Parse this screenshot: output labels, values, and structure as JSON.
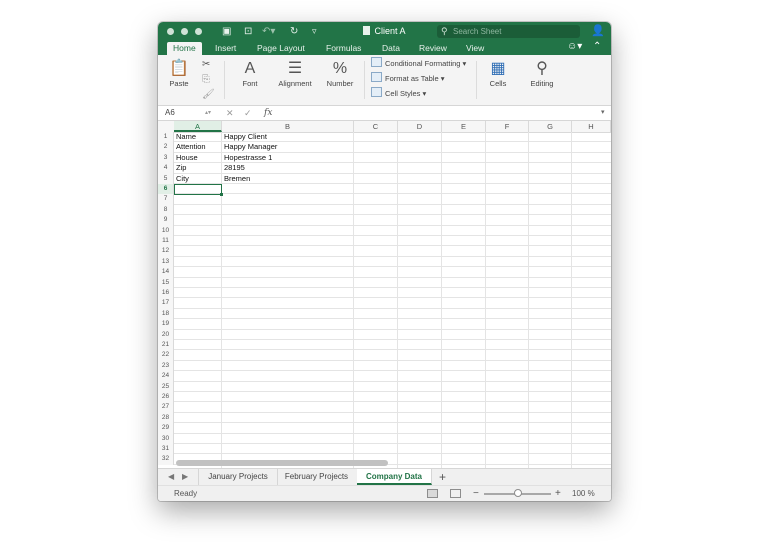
{
  "window": {
    "title": "Client A"
  },
  "search": {
    "placeholder": "Search Sheet"
  },
  "tabs": [
    "Home",
    "Insert",
    "Page Layout",
    "Formulas",
    "Data",
    "Review",
    "View"
  ],
  "ribbon": {
    "paste": "Paste",
    "font": "Font",
    "alignment": "Alignment",
    "number": "Number",
    "conditional_formatting": "Conditional Formatting",
    "format_as_table": "Format as Table",
    "cell_styles": "Cell Styles",
    "cells": "Cells",
    "editing": "Editing"
  },
  "formula_bar": {
    "name_box": "A6",
    "fx": "fx",
    "formula": ""
  },
  "columns": [
    "A",
    "B",
    "C",
    "D",
    "E",
    "F",
    "G",
    "H"
  ],
  "rows": [
    "1",
    "2",
    "3",
    "4",
    "5",
    "6",
    "7",
    "8",
    "9",
    "10",
    "11",
    "12",
    "13",
    "14",
    "15",
    "16",
    "17",
    "18",
    "19",
    "20",
    "21",
    "22",
    "23",
    "24",
    "25",
    "26",
    "27",
    "28",
    "29",
    "30",
    "31",
    "32"
  ],
  "cells": {
    "A1": "Name",
    "B1": "Happy Client",
    "A2": "Attention",
    "B2": "Happy Manager",
    "A3": "House",
    "B3": "Hopestrasse 1",
    "A4": "Zip",
    "B4": "28195",
    "A5": "City",
    "B5": "Bremen"
  },
  "selected_cell": "A6",
  "sheets": [
    "January Projects",
    "February Projects",
    "Company Data"
  ],
  "active_sheet": "Company Data",
  "status": {
    "text": "Ready",
    "zoom": "100 %",
    "zoom_level": 1.0
  },
  "colors": {
    "accent": "#227447",
    "ribbon_bg": "#f4f4f4",
    "grid_line": "#e4e4e4"
  },
  "icons": [
    "close-window-icon",
    "minimize-window-icon",
    "zoom-window-icon",
    "sidebar-toggle-icon",
    "save-icon",
    "undo-icon",
    "redo-icon",
    "customize-toolbar-icon",
    "document-icon",
    "search-icon",
    "share-user-icon",
    "smiley-feedback-icon",
    "collapse-ribbon-icon",
    "paste-icon",
    "cut-icon",
    "copy-icon",
    "format-painter-icon",
    "font-icon",
    "alignment-icon",
    "number-icon",
    "conditional-formatting-icon",
    "format-as-table-icon",
    "cell-styles-icon",
    "cells-icon",
    "editing-icon",
    "cancel-icon",
    "enter-icon",
    "normal-view-icon",
    "page-layout-view-icon",
    "zoom-out-icon",
    "zoom-in-icon"
  ]
}
